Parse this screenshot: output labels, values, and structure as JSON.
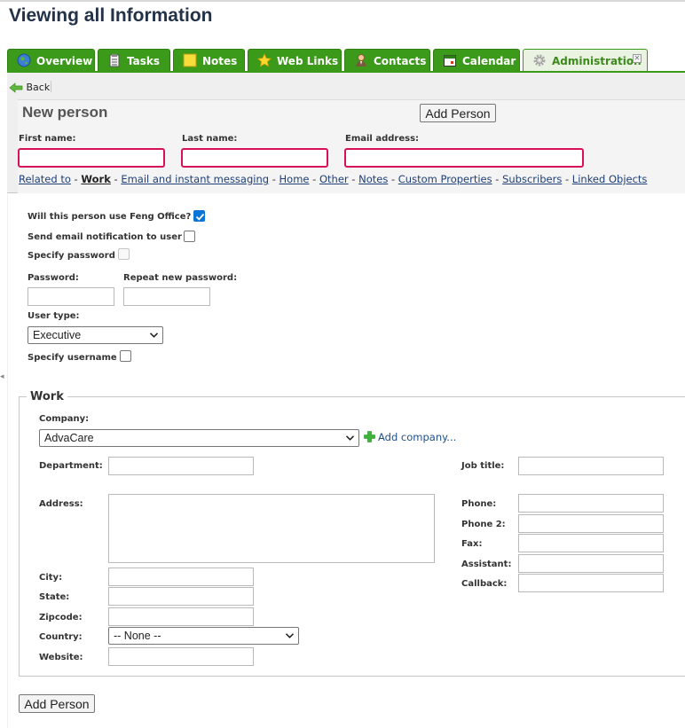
{
  "page": {
    "title": "Viewing all Information"
  },
  "tabs": [
    {
      "label": "Overview",
      "icon": "globe-icon"
    },
    {
      "label": "Tasks",
      "icon": "tasks-icon"
    },
    {
      "label": "Notes",
      "icon": "note-icon"
    },
    {
      "label": "Web Links",
      "icon": "star-icon"
    },
    {
      "label": "Contacts",
      "icon": "contact-icon"
    },
    {
      "label": "Calendar",
      "icon": "calendar-icon"
    },
    {
      "label": "Administration",
      "icon": "gear-icon",
      "active": true
    }
  ],
  "colors": {
    "tab_bg": "#3c9a1b",
    "required_border": "#d6115a",
    "title": "#233248",
    "link": "#1f3f75"
  },
  "header": {
    "back_label": "Back",
    "form_title": "New person",
    "add_button_label": "Add Person",
    "first_name_label": "First name:",
    "last_name_label": "Last name:",
    "email_label": "Email address:",
    "first_name_value": "",
    "last_name_value": "",
    "email_value": ""
  },
  "section_links": [
    {
      "label": "Related to"
    },
    {
      "label": "Work",
      "current": true
    },
    {
      "label": "Email and instant messaging"
    },
    {
      "label": "Home"
    },
    {
      "label": "Other"
    },
    {
      "label": "Notes"
    },
    {
      "label": "Custom Properties"
    },
    {
      "label": "Subscribers"
    },
    {
      "label": "Linked Objects"
    }
  ],
  "link_separator": "-",
  "user": {
    "use_feng_label": "Will this person use Feng Office?",
    "use_feng_checked": true,
    "send_email_label": "Send email notification to user",
    "send_email_checked": false,
    "specify_password_label": "Specify password",
    "specify_password_checked": false,
    "password_label": "Password:",
    "repeat_password_label": "Repeat new password:",
    "user_type_label": "User type:",
    "user_type_value": "Executive",
    "specify_username_label": "Specify username",
    "specify_username_checked": false
  },
  "work": {
    "legend": "Work",
    "company_label": "Company:",
    "company_value": "AdvaCare",
    "add_company_label": "Add company...",
    "department_label": "Department:",
    "job_title_label": "Job title:",
    "address_label": "Address:",
    "phone_label": "Phone:",
    "phone2_label": "Phone 2:",
    "fax_label": "Fax:",
    "assistant_label": "Assistant:",
    "callback_label": "Callback:",
    "city_label": "City:",
    "state_label": "State:",
    "zipcode_label": "Zipcode:",
    "country_label": "Country:",
    "country_value": "-- None --",
    "website_label": "Website:"
  },
  "footer": {
    "add_button_label": "Add Person"
  }
}
